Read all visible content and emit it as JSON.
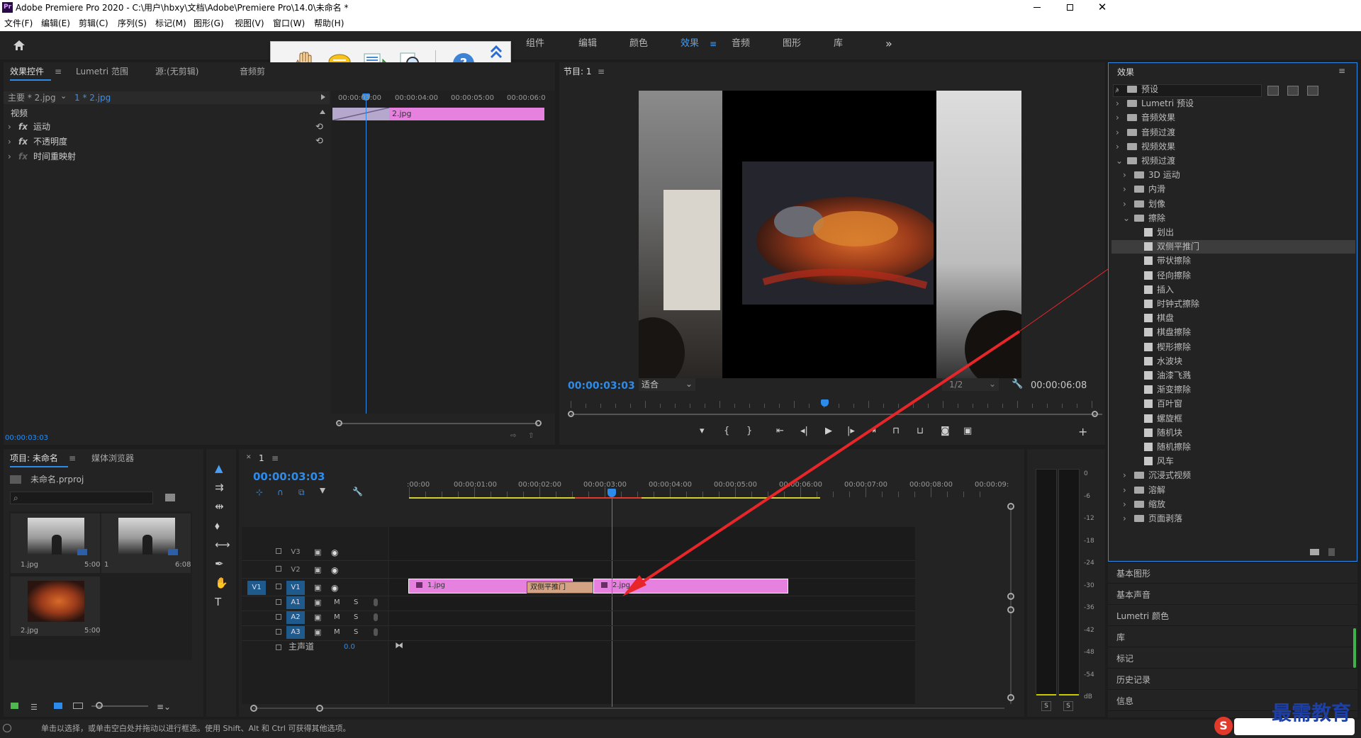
{
  "window": {
    "title": "Adobe Premiere Pro 2020 - C:\\用户\\hbxy\\文档\\Adobe\\Premiere Pro\\14.0\\未命名 *",
    "app_icon": "Pr"
  },
  "menu": [
    "文件(F)",
    "编辑(E)",
    "剪辑(C)",
    "序列(S)",
    "标记(M)",
    "图形(G)",
    "视图(V)",
    "窗口(W)",
    "帮助(H)"
  ],
  "workspaces": [
    "组件",
    "编辑",
    "颜色",
    "效果",
    "音频",
    "图形",
    "库"
  ],
  "workspace_active": "效果",
  "source_panel": {
    "tabs": [
      "效果控件",
      "Lumetri 范围",
      "源:(无剪辑)",
      "音频剪"
    ],
    "master": "主要 * 2.jpg",
    "clip": "1 * 2.jpg",
    "section": "视频",
    "effects": [
      "运动",
      "不透明度",
      "时间重映射"
    ],
    "fx": "fx",
    "ruler": [
      "00:00:03:00",
      "00:00:04:00",
      "00:00:05:00",
      "00:00:06:0"
    ],
    "clip_label": "2.jpg",
    "timecode": "00:00:03:03"
  },
  "program": {
    "title": "节目: 1",
    "timecode": "00:00:03:03",
    "fit": "适合",
    "quality": "1/2",
    "duration": "00:00:06:08"
  },
  "effects_panel": {
    "title": "效果",
    "items": [
      {
        "t": "预设",
        "lvl": 0,
        "type": "folder",
        "exp": "›"
      },
      {
        "t": "Lumetri 预设",
        "lvl": 0,
        "type": "folder",
        "exp": "›"
      },
      {
        "t": "音频效果",
        "lvl": 0,
        "type": "folder",
        "exp": "›"
      },
      {
        "t": "音频过渡",
        "lvl": 0,
        "type": "folder",
        "exp": "›"
      },
      {
        "t": "视频效果",
        "lvl": 0,
        "type": "folder",
        "exp": "›"
      },
      {
        "t": "视频过渡",
        "lvl": 0,
        "type": "folder",
        "exp": "⌄"
      },
      {
        "t": "3D 运动",
        "lvl": 1,
        "type": "folder",
        "exp": "›"
      },
      {
        "t": "内滑",
        "lvl": 1,
        "type": "folder",
        "exp": "›"
      },
      {
        "t": "划像",
        "lvl": 1,
        "type": "folder",
        "exp": "›"
      },
      {
        "t": "擦除",
        "lvl": 1,
        "type": "folder",
        "exp": "⌄"
      },
      {
        "t": "划出",
        "lvl": 2,
        "type": "effect"
      },
      {
        "t": "双侧平推门",
        "lvl": 2,
        "type": "effect",
        "sel": true
      },
      {
        "t": "带状擦除",
        "lvl": 2,
        "type": "effect"
      },
      {
        "t": "径向擦除",
        "lvl": 2,
        "type": "effect"
      },
      {
        "t": "插入",
        "lvl": 2,
        "type": "effect"
      },
      {
        "t": "时钟式擦除",
        "lvl": 2,
        "type": "effect"
      },
      {
        "t": "棋盘",
        "lvl": 2,
        "type": "effect"
      },
      {
        "t": "棋盘擦除",
        "lvl": 2,
        "type": "effect"
      },
      {
        "t": "楔形擦除",
        "lvl": 2,
        "type": "effect"
      },
      {
        "t": "水波块",
        "lvl": 2,
        "type": "effect"
      },
      {
        "t": "油漆飞溅",
        "lvl": 2,
        "type": "effect"
      },
      {
        "t": "渐变擦除",
        "lvl": 2,
        "type": "effect"
      },
      {
        "t": "百叶窗",
        "lvl": 2,
        "type": "effect"
      },
      {
        "t": "螺旋框",
        "lvl": 2,
        "type": "effect"
      },
      {
        "t": "随机块",
        "lvl": 2,
        "type": "effect"
      },
      {
        "t": "随机擦除",
        "lvl": 2,
        "type": "effect"
      },
      {
        "t": "风车",
        "lvl": 2,
        "type": "effect"
      },
      {
        "t": "沉浸式视频",
        "lvl": 1,
        "type": "folder",
        "exp": "›"
      },
      {
        "t": "溶解",
        "lvl": 1,
        "type": "folder",
        "exp": "›"
      },
      {
        "t": "缩放",
        "lvl": 1,
        "type": "folder",
        "exp": "›"
      },
      {
        "t": "页面剥落",
        "lvl": 1,
        "type": "folder",
        "exp": "›"
      }
    ]
  },
  "side_panels": [
    "基本图形",
    "基本声音",
    "Lumetri 颜色",
    "库",
    "标记",
    "历史记录",
    "信息"
  ],
  "project": {
    "tabs": [
      "项目: 未命名",
      "媒体浏览器"
    ],
    "file": "未命名.prproj",
    "items": [
      {
        "name": "1.jpg",
        "dur": "5:00"
      },
      {
        "name": "1",
        "dur": "6:08"
      },
      {
        "name": "2.jpg",
        "dur": "5:00"
      }
    ]
  },
  "timeline": {
    "tab": "1",
    "timecode": "00:00:03:03",
    "ruler": [
      ":00:00",
      "00:00:01:00",
      "00:00:02:00",
      "00:00:03:00",
      "00:00:04:00",
      "00:00:05:00",
      "00:00:06:00",
      "00:00:07:00",
      "00:00:08:00",
      "00:00:09:"
    ],
    "video_tracks": [
      "V3",
      "V2",
      "V1"
    ],
    "audio_tracks": [
      "A1",
      "A2",
      "A3"
    ],
    "source_patch": "V1",
    "master": "主声道",
    "master_val": "0.0",
    "m": "M",
    "s": "S",
    "clips": {
      "c1": "1.jpg",
      "tr": "双侧平推门",
      "c2": "2.jpg"
    }
  },
  "meter": {
    "scale": [
      "0",
      "-6",
      "-12",
      "-18",
      "-24",
      "-30",
      "-36",
      "-42",
      "-48",
      "-54",
      "dB"
    ],
    "solo": [
      "S",
      "S"
    ]
  },
  "status": "单击以选择，或单击空白处并拖动以进行框选。使用 Shift、Alt 和 Ctrl 可获得其他选项。",
  "watermark": "最需教育",
  "colors": {
    "accent": "#2d8ceb",
    "clip": "#e681e0",
    "arrow": "#e8262a",
    "timecode": "#2d8ceb"
  }
}
